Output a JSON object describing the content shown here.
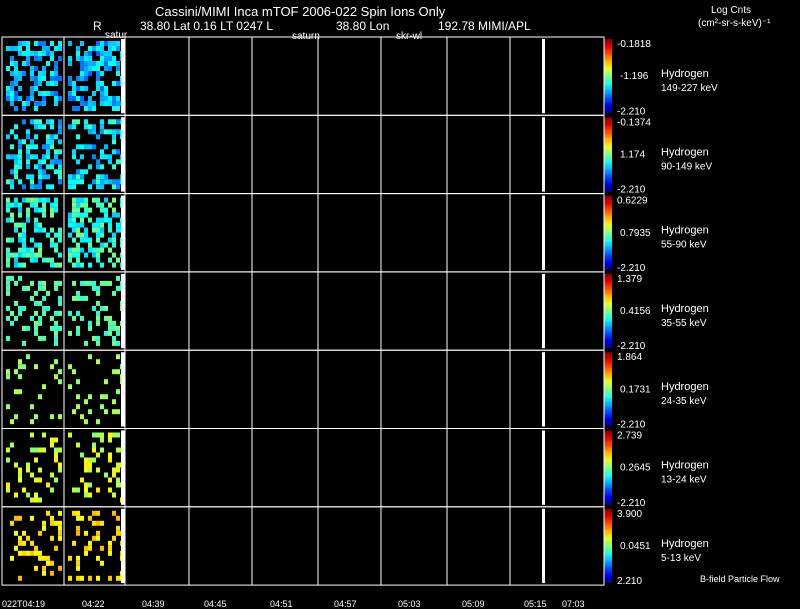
{
  "header": {
    "title": "Cassini/MIMI Inca mTOF  2006-022   Spin    Ions Only",
    "line2_r": "R",
    "line2_lat": "38.80 Lat 0.16 LT 0247 L",
    "line2_lon": "38.80 Lon",
    "line2_right": "192.78   MIMI/APL",
    "marker_saturn1": "satur",
    "marker_saturn2": "saturn",
    "marker_skr": "skr-wl"
  },
  "legend_title": {
    "line1": "Log Cnts",
    "line2": "(cm²-sr-s-keV)⁻¹"
  },
  "footer_note": "B-field Particle Flow",
  "chart_data": {
    "type": "heatmap",
    "x_tick_labels": [
      "022T04:19",
      "04:22",
      "04:39",
      "04:45",
      "04:51",
      "04:57",
      "05:03",
      "05:09",
      "05:15",
      "07:03"
    ],
    "panels": [
      {
        "species": "Hydrogen",
        "energy": "149-227 keV",
        "cmax": "-0.1818",
        "cmid": "-1.196",
        "cmin": "-2.210",
        "density": 0.55,
        "hue_lo": 0.78,
        "hue_hi": 0.6
      },
      {
        "species": "Hydrogen",
        "energy": "90-149 keV",
        "cmax": "-0.1374",
        "cmid": "1.174",
        "cmin": "-2.210",
        "density": 0.45,
        "hue_lo": 0.75,
        "hue_hi": 0.55
      },
      {
        "species": "Hydrogen",
        "energy": "55-90 keV",
        "cmax": "0.6229",
        "cmid": "0.7935",
        "cmin": "-2.210",
        "density": 0.5,
        "hue_lo": 0.68,
        "hue_hi": 0.5
      },
      {
        "species": "Hydrogen",
        "energy": "35-55 keV",
        "cmax": "1.379",
        "cmid": "0.4156",
        "cmin": "-2.210",
        "density": 0.3,
        "hue_lo": 0.6,
        "hue_hi": 0.5
      },
      {
        "species": "Hydrogen",
        "energy": "24-35 keV",
        "cmax": "1.864",
        "cmid": "0.1731",
        "cmin": "-2.210",
        "density": 0.15,
        "hue_lo": 0.5,
        "hue_hi": 0.45
      },
      {
        "species": "Hydrogen",
        "energy": "13-24 keV",
        "cmax": "2.739",
        "cmid": "0.2645",
        "cmin": "-2.210",
        "density": 0.2,
        "hue_lo": 0.5,
        "hue_hi": 0.35
      },
      {
        "species": "Hydrogen",
        "energy": "5-13 keV",
        "cmax": "3.900",
        "cmid": "0.0451",
        "cmin": "2.210",
        "density": 0.25,
        "hue_lo": 0.4,
        "hue_hi": 0.3
      }
    ]
  }
}
